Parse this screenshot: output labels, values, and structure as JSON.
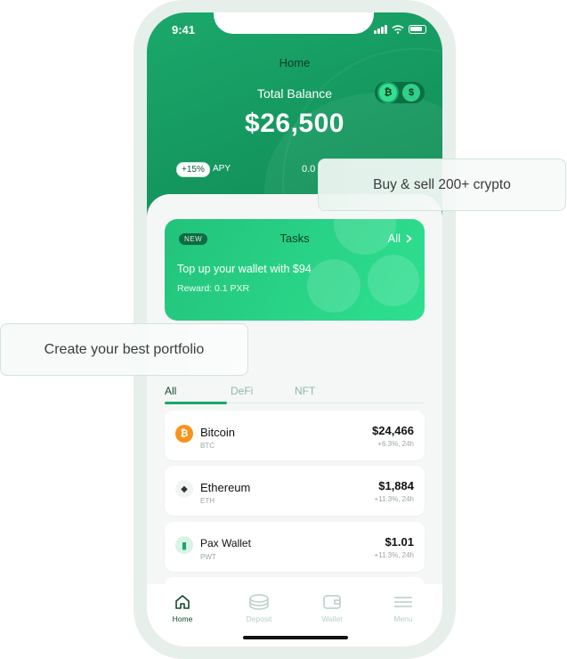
{
  "status_bar": {
    "time": "9:41"
  },
  "hero": {
    "title": "Home",
    "balance_label": "Total Balance",
    "balance_value": "$26,500",
    "apy_badge": "+15%",
    "apy_label": "APY",
    "apy_value": "0.0"
  },
  "toggle": {
    "left_symbol": "₿",
    "right_symbol": "$"
  },
  "tasks": {
    "badge": "NEW",
    "title": "Tasks",
    "all_label": "All",
    "description": "Top up your wallet with $94",
    "reward": "Reward: 0.1 PXR"
  },
  "tabs": [
    {
      "label": "All",
      "active": true
    },
    {
      "label": "DeFi",
      "active": false
    },
    {
      "label": "NFT",
      "active": false
    }
  ],
  "assets": [
    {
      "name": "Bitcoin",
      "symbol": "BTC",
      "price": "$24,466",
      "change": "+6.3%, 24h",
      "icon": "bitcoin-icon",
      "color": "#f7931a",
      "glyph": "₿"
    },
    {
      "name": "Ethereum",
      "symbol": "ETH",
      "price": "$1,884",
      "change": "+11.3%, 24h",
      "icon": "ethereum-icon",
      "color": "#ffffff",
      "glyph": "◆"
    },
    {
      "name": "Pax Wallet",
      "symbol": "PWT",
      "price": "$1.01",
      "change": "+11.3%, 24h",
      "icon": "pax-wallet-icon",
      "color": "#d9f3e6",
      "glyph": "▮"
    }
  ],
  "bottom_nav": [
    {
      "label": "Home",
      "active": true,
      "icon": "home-icon"
    },
    {
      "label": "Deposit",
      "active": false,
      "icon": "deposit-icon"
    },
    {
      "label": "Wallet",
      "active": false,
      "icon": "wallet-icon"
    },
    {
      "label": "Menu",
      "active": false,
      "icon": "menu-icon"
    }
  ],
  "callouts": {
    "buy_sell": "Buy & sell 200+ crypto",
    "portfolio": "Create your best portfolio"
  },
  "colors": {
    "brand": "#1ba86b",
    "accent": "#2ee090",
    "dark": "#13492f"
  }
}
